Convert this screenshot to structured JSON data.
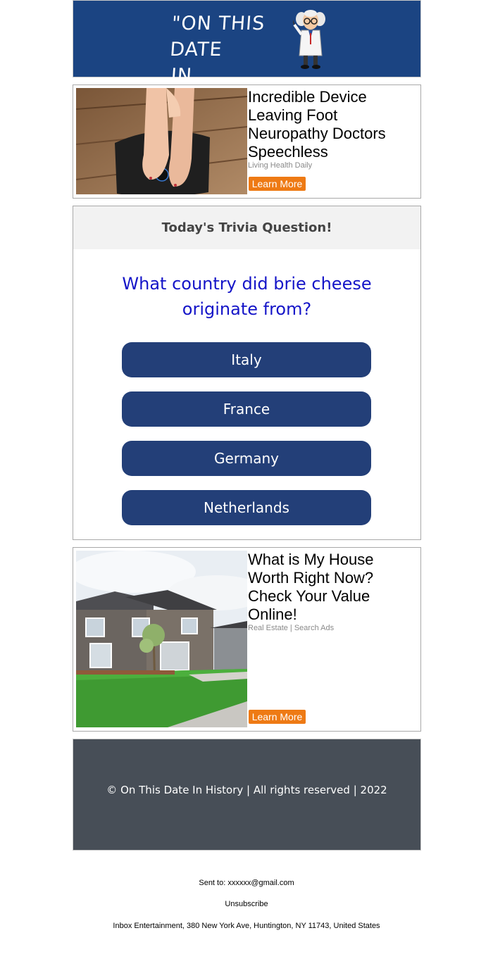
{
  "header": {
    "title_line1": "\"ON THIS DATE",
    "title_line2": "IN HISTORY...\"",
    "mascot_icon": "professor-mascot-icon",
    "background_color": "#1b4482"
  },
  "ads": [
    {
      "headline": "Incredible Device Leaving Foot Neuropathy Doctors Speechless",
      "source": "Living Health Daily",
      "button_label": "Learn More",
      "image_icon": "foot-massager-photo"
    },
    {
      "headline": "What is My House Worth Right Now? Check Your Value Online!",
      "source": "Real Estate | Search Ads",
      "button_label": "Learn More",
      "image_icon": "house-photo"
    }
  ],
  "trivia": {
    "heading": "Today's Trivia Question!",
    "question": "What country did brie cheese originate from?",
    "answers": [
      "Italy",
      "France",
      "Germany",
      "Netherlands"
    ],
    "question_color": "#1515c8",
    "button_color": "#233f78"
  },
  "footer": {
    "copyright": "© On This Date In History | All rights reserved | 2022",
    "background_color": "#474e57"
  },
  "meta": {
    "sent_to": "Sent to: xxxxxx@gmail.com",
    "unsubscribe": "Unsubscribe",
    "address": "Inbox Entertainment, 380 New York Ave, Huntington, NY 11743, United States"
  },
  "accent_color": "#ee7a14"
}
